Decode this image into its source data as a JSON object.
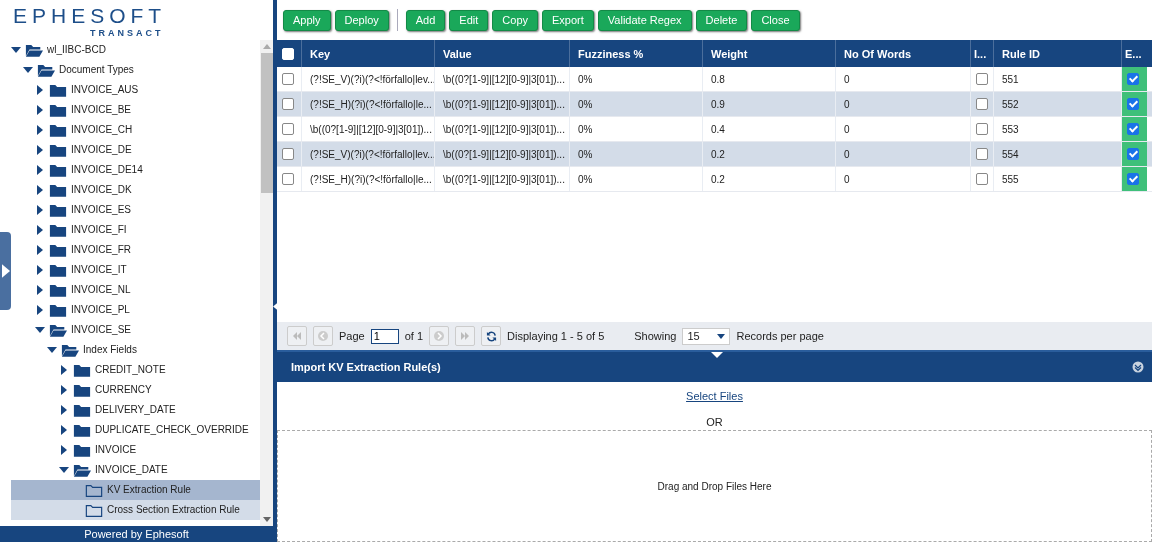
{
  "logo": {
    "name": "EPHESOFT",
    "tagline": "TRANSACT"
  },
  "tree": [
    {
      "label": "wl_IIBC-BCD",
      "kind": "folder",
      "expanded": true,
      "children": [
        {
          "label": "Document Types",
          "kind": "folder",
          "expanded": true,
          "children": [
            {
              "label": "INVOICE_AUS",
              "kind": "folder",
              "expanded": false
            },
            {
              "label": "INVOICE_BE",
              "kind": "folder",
              "expanded": false
            },
            {
              "label": "INVOICE_CH",
              "kind": "folder",
              "expanded": false
            },
            {
              "label": "INVOICE_DE",
              "kind": "folder",
              "expanded": false
            },
            {
              "label": "INVOICE_DE14",
              "kind": "folder",
              "expanded": false
            },
            {
              "label": "INVOICE_DK",
              "kind": "folder",
              "expanded": false
            },
            {
              "label": "INVOICE_ES",
              "kind": "folder",
              "expanded": false
            },
            {
              "label": "INVOICE_FI",
              "kind": "folder",
              "expanded": false
            },
            {
              "label": "INVOICE_FR",
              "kind": "folder",
              "expanded": false
            },
            {
              "label": "INVOICE_IT",
              "kind": "folder",
              "expanded": false
            },
            {
              "label": "INVOICE_NL",
              "kind": "folder",
              "expanded": false
            },
            {
              "label": "INVOICE_PL",
              "kind": "folder",
              "expanded": false
            },
            {
              "label": "INVOICE_SE",
              "kind": "folder",
              "expanded": true,
              "children": [
                {
                  "label": "Index Fields",
                  "kind": "folder",
                  "expanded": true,
                  "children": [
                    {
                      "label": "CREDIT_NOTE",
                      "kind": "folder",
                      "expanded": false
                    },
                    {
                      "label": "CURRENCY",
                      "kind": "folder",
                      "expanded": false
                    },
                    {
                      "label": "DELIVERY_DATE",
                      "kind": "folder",
                      "expanded": false
                    },
                    {
                      "label": "DUPLICATE_CHECK_OVERRIDE",
                      "kind": "folder",
                      "expanded": false
                    },
                    {
                      "label": "INVOICE",
                      "kind": "folder",
                      "expanded": false
                    },
                    {
                      "label": "INVOICE_DATE",
                      "kind": "folder",
                      "expanded": true,
                      "children": [
                        {
                          "label": "KV Extraction Rule",
                          "kind": "rule",
                          "selected": true,
                          "hovered": false
                        },
                        {
                          "label": "Cross Section Extraction Rule",
                          "kind": "rule",
                          "selected": false,
                          "hovered": true
                        }
                      ]
                    }
                  ]
                }
              ]
            }
          ]
        }
      ]
    }
  ],
  "footer": "Powered by Ephesoft",
  "toolbar_groups": [
    {
      "buttons": [
        "Apply",
        "Deploy"
      ]
    },
    {
      "buttons": [
        "Add",
        "Edit",
        "Copy",
        "Export",
        "Validate Regex",
        "Delete",
        "Close"
      ]
    }
  ],
  "table": {
    "columns": [
      "Key",
      "Value",
      "Fuzziness %",
      "Weight",
      "No Of Words",
      "I...",
      "Rule ID",
      "E..."
    ],
    "header_checked": false,
    "rows": [
      {
        "checked": false,
        "key": "(?!SE_V)(?i)(?<!förfallo|lev...",
        "value": "\\b((0?[1-9]|[12][0-9]|3[01])...",
        "fuzziness": "0%",
        "weight": "0.8",
        "words": "0",
        "i": false,
        "rule_id": "551",
        "e": true
      },
      {
        "checked": false,
        "key": "(?!SE_H)(?i)(?<!förfallo|le...",
        "value": "\\b((0?[1-9]|[12][0-9]|3[01])...",
        "fuzziness": "0%",
        "weight": "0.9",
        "words": "0",
        "i": false,
        "rule_id": "552",
        "e": true
      },
      {
        "checked": false,
        "key": "\\b((0?[1-9]|[12][0-9]|3[01])...",
        "value": "\\b((0?[1-9]|[12][0-9]|3[01])...",
        "fuzziness": "0%",
        "weight": "0.4",
        "words": "0",
        "i": false,
        "rule_id": "553",
        "e": true
      },
      {
        "checked": false,
        "key": "(?!SE_V)(?i)(?<!förfallo|lev...",
        "value": "\\b((0?[1-9]|[12][0-9]|3[01])...",
        "fuzziness": "0%",
        "weight": "0.2",
        "words": "0",
        "i": false,
        "rule_id": "554",
        "e": true
      },
      {
        "checked": false,
        "key": "(?!SE_H)(?i)(?<!förfallo|le...",
        "value": "\\b((0?[1-9]|[12][0-9]|3[01])...",
        "fuzziness": "0%",
        "weight": "0.2",
        "words": "0",
        "i": false,
        "rule_id": "555",
        "e": true
      }
    ]
  },
  "pager": {
    "page_label": "Page",
    "page": "1",
    "of": "of 1",
    "displaying": "Displaying 1 - 5 of 5",
    "showing": "Showing",
    "per_page": "15",
    "records": "Records per page"
  },
  "import": {
    "title": "Import KV Extraction Rule(s)",
    "link": "Select Files",
    "or": "OR",
    "drop": "Drag and Drop Files Here"
  }
}
